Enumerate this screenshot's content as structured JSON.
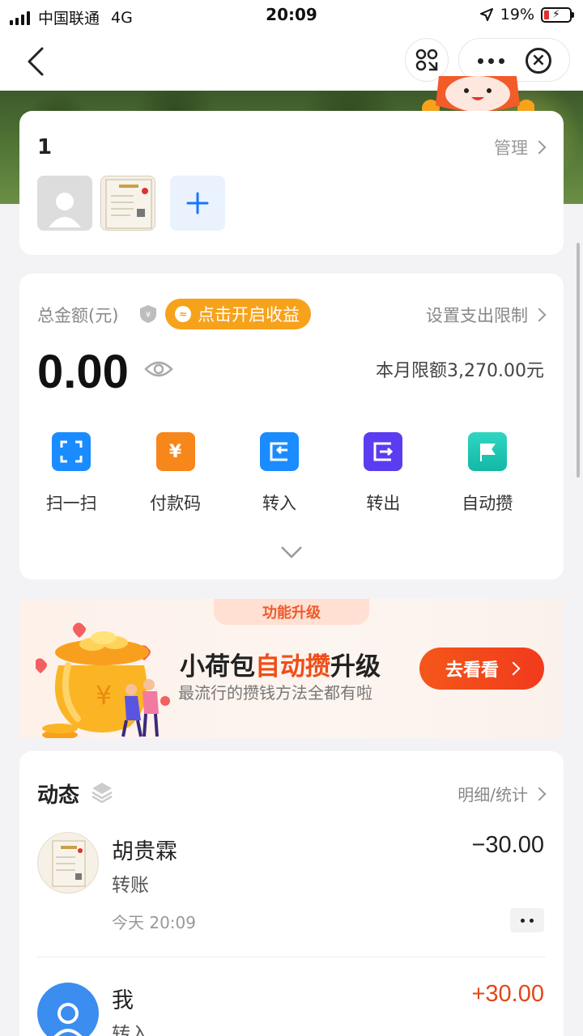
{
  "status_bar": {
    "carrier": "中国联通",
    "network": "4G",
    "time": "20:09",
    "battery": "19%"
  },
  "nav": {
    "back_icon": "chevron-left-icon",
    "scan_icon": "mini-program-scan-icon",
    "more_icon": "more-dots-icon",
    "close_icon": "close-circle-icon"
  },
  "members": {
    "title": "1",
    "manage_label": "管理",
    "add_icon": "plus-icon"
  },
  "balance": {
    "label": "总金额(元)",
    "earn_label": "点击开启收益",
    "limit_setting_label": "设置支出限制",
    "amount": "0.00",
    "monthly_limit": "本月限额3,270.00元",
    "actions": [
      {
        "label": "扫一扫",
        "icon": "scan-icon",
        "color": "#1a8cff"
      },
      {
        "label": "付款码",
        "icon": "yuan-icon",
        "color": "#f7861b"
      },
      {
        "label": "转入",
        "icon": "transfer-in-icon",
        "color": "#1a8cff"
      },
      {
        "label": "转出",
        "icon": "transfer-out-icon",
        "color": "#5b3cf0"
      },
      {
        "label": "自动攒",
        "icon": "flag-icon",
        "color": "#1ec8b4"
      }
    ]
  },
  "promo": {
    "tag": "功能升级",
    "title_prefix": "小荷包",
    "title_highlight": "自动攒",
    "title_suffix": "升级",
    "subtitle": "最流行的攒钱方法全都有啦",
    "button_label": "去看看"
  },
  "activity": {
    "title": "动态",
    "detail_link": "明细/统计",
    "items": [
      {
        "name": "胡贵霖",
        "type": "转账",
        "time": "今天 20:09",
        "amount": "−30.00",
        "amount_color": "#222222"
      },
      {
        "name": "我",
        "type": "转入",
        "time": "",
        "amount": "+30.00",
        "amount_color": "#e2471a"
      }
    ]
  },
  "colors": {
    "accent_blue": "#1677ff",
    "earn_orange": "#f7a21b",
    "promo_red": "#f04d18"
  }
}
